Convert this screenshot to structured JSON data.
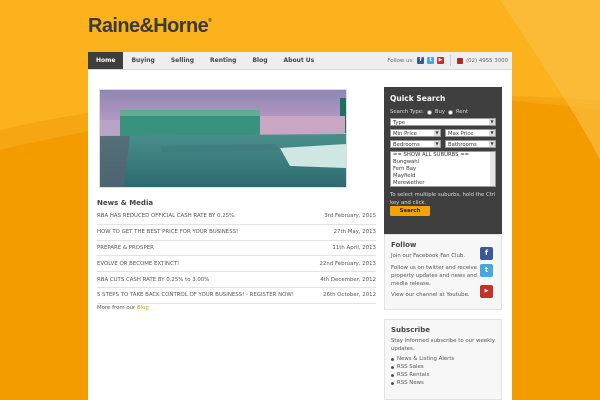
{
  "brand": {
    "name": "Raine&Horne",
    "trademark": "®",
    "accent": "#f7a200"
  },
  "nav": {
    "items": [
      "Home",
      "Buying",
      "Selling",
      "Renting",
      "Blog",
      "About Us"
    ],
    "active": "Home",
    "follow_label": "Follow us:",
    "social_icons": [
      "facebook-icon",
      "twitter-icon",
      "youtube-icon"
    ],
    "phone": "(02) 4955 3000"
  },
  "news": {
    "heading": "News & Media",
    "items": [
      {
        "title": "RBA HAS REDUCED OFFICIAL CASH RATE BY 0.25%.",
        "date": "3rd February, 2015"
      },
      {
        "title": "HOW TO GET THE BEST PRICE FOR YOUR BUSINESS!",
        "date": "27th May, 2013"
      },
      {
        "title": "PREPARE & PROSPER",
        "date": "11th April, 2013"
      },
      {
        "title": "EVOLVE OR BECOME EXTINCT!",
        "date": "22nd February, 2013"
      },
      {
        "title": "RBA CUTS CASH RATE BY 0.25% to 3.00%",
        "date": "4th December, 2012"
      },
      {
        "title": "5 STEPS TO TAKE BACK CONTROL OF YOUR BUSINESS! - REGISTER NOW!",
        "date": "26th October, 2012"
      }
    ],
    "more_prefix": "More from our ",
    "more_link": "Blog"
  },
  "quick_search": {
    "heading": "Quick Search",
    "type_label": "Search Type:",
    "type_options": [
      "Buy",
      "Rent"
    ],
    "type_select": "Type",
    "min_price": "Min Price",
    "max_price": "Max Price",
    "bedrooms": "Bedrooms",
    "bathrooms": "Bathrooms",
    "suburbs": [
      "== SHOW ALL SUBURBS ==",
      "Bungwahl",
      "Fern Bay",
      "Mayfield",
      "Merewether"
    ],
    "hint": "To select multiple suburbs, hold the Ctrl key and click.",
    "button": "Search"
  },
  "follow": {
    "heading": "Follow",
    "facebook": "Join our Facebook Fan Club.",
    "twitter": "Follow us on twitter and receive property updates and news and media release.",
    "youtube": "View our channel at Youtube."
  },
  "subscribe": {
    "heading": "Subscribe",
    "text": "Stay informed subscribe to our weekly updates.",
    "items": [
      "News & Listing Alerts",
      "RSS Sales",
      "RSS Rentals",
      "RSS News"
    ]
  }
}
